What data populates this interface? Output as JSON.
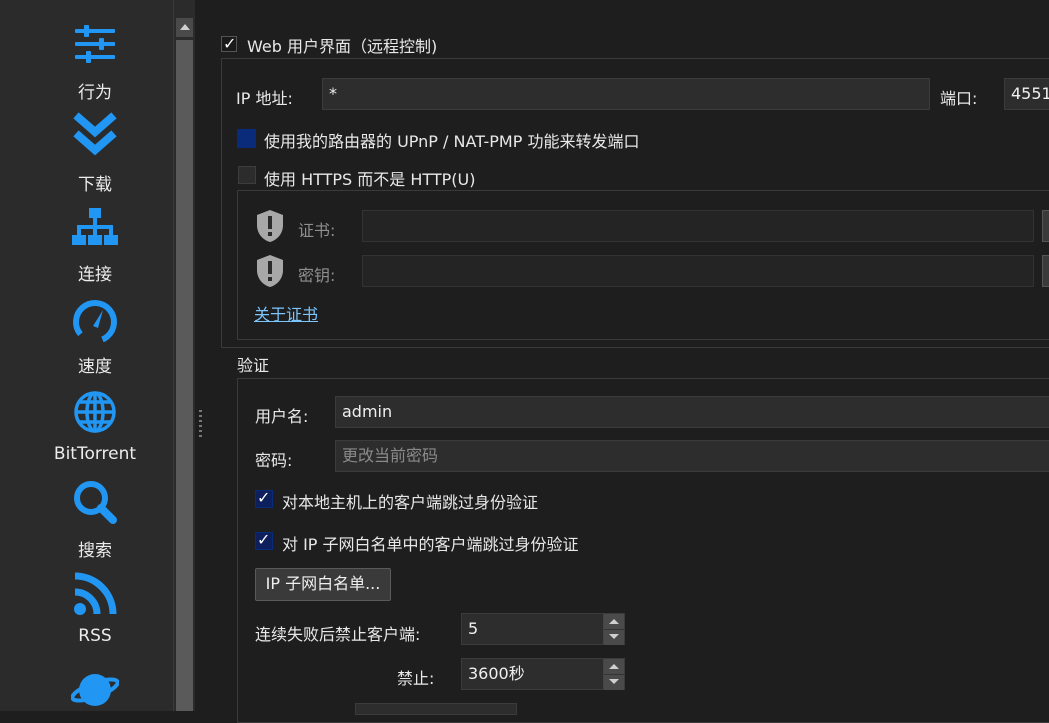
{
  "sidebar": {
    "items": [
      {
        "label": "行为",
        "icon": "sliders-icon"
      },
      {
        "label": "下载",
        "icon": "double-chevron-down-icon"
      },
      {
        "label": "连接",
        "icon": "network-icon"
      },
      {
        "label": "速度",
        "icon": "speedometer-icon"
      },
      {
        "label": "BitTorrent",
        "icon": "globe-icon"
      },
      {
        "label": "搜索",
        "icon": "search-icon"
      },
      {
        "label": "RSS",
        "icon": "rss-icon"
      },
      {
        "label": "",
        "icon": "planet-icon"
      }
    ]
  },
  "webui": {
    "enable_label": "Web 用户界面（远程控制)",
    "enabled": true,
    "ip_label": "IP 地址:",
    "ip_value": "*",
    "port_label": "端口:",
    "port_value": "4551",
    "upnp_label": "使用我的路由器的 UPnP / NAT-PMP 功能来转发端口",
    "upnp_checked": false,
    "https_label": "使用 HTTPS 而不是 HTTP(U)",
    "https_checked": false,
    "cert_label": "证书:",
    "cert_value": "",
    "key_label": "密钥:",
    "key_value": "",
    "about_cert_link": "关于证书"
  },
  "auth": {
    "section_title": "验证",
    "username_label": "用户名:",
    "username_value": "admin",
    "password_label": "密码:",
    "password_placeholder": "更改当前密码",
    "bypass_localhost_label": "对本地主机上的客户端跳过身份验证",
    "bypass_localhost_checked": true,
    "bypass_whitelist_label": "对 IP 子网白名单中的客户端跳过身份验证",
    "bypass_whitelist_checked": true,
    "whitelist_button": "IP 子网白名单...",
    "ban_after_label": "连续失败后禁止客户端:",
    "ban_after_value": "5",
    "ban_duration_label": "禁止:",
    "ban_duration_value": "3600秒"
  },
  "colors": {
    "accent": "#2196f3",
    "background": "#1e1e1e",
    "sidebar": "#2b2b2b"
  }
}
